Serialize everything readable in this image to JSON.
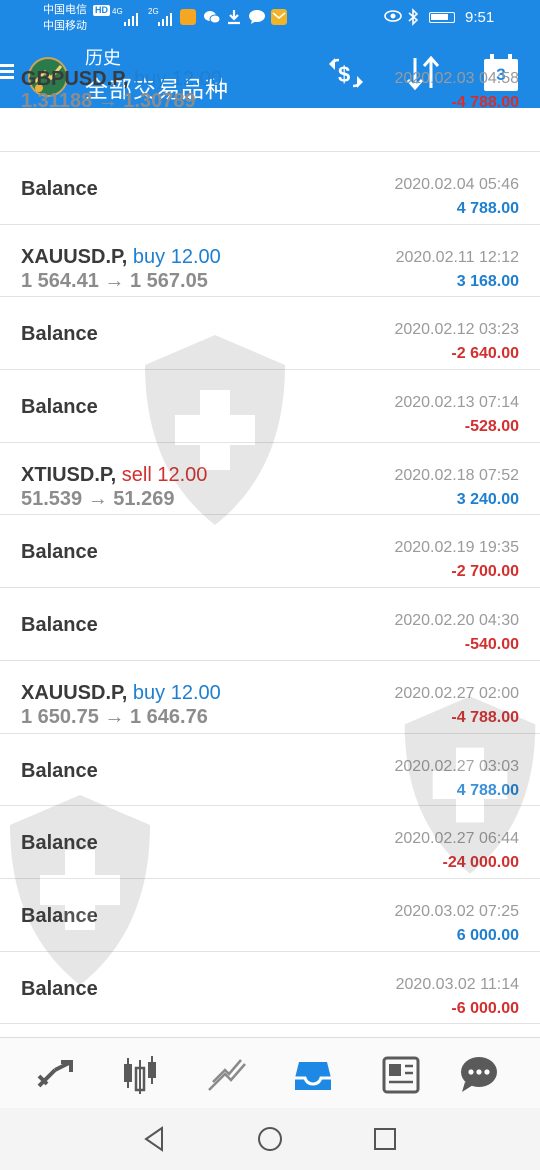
{
  "status_bar": {
    "carrier1": "中国电信",
    "carrier2": "中国移动",
    "hd": "HD",
    "net1": "4G",
    "net2": "2G",
    "time": "9:51"
  },
  "header": {
    "title": "历史",
    "subtitle": "全部交易品种",
    "calendar_day": "3",
    "icons": [
      "menu-icon",
      "app-logo",
      "currency-exchange-icon",
      "sort-icon",
      "calendar-icon"
    ]
  },
  "rows": [
    {
      "type": "trade",
      "symbol": "GBPUSD.P,",
      "side": "buy",
      "qty": "12.00",
      "prices": "1.31188 → 1.30789",
      "date": "2020.02.03 04:58",
      "amount": "-4 788.00",
      "sign": "neg"
    },
    {
      "type": "balance",
      "label": "Balance",
      "date": "2020.02.04 05:46",
      "amount": "4 788.00",
      "sign": "pos"
    },
    {
      "type": "trade",
      "symbol": "XAUUSD.P,",
      "side": "buy",
      "qty": "12.00",
      "prices": "1 564.41 → 1 567.05",
      "date": "2020.02.11 12:12",
      "amount": "3 168.00",
      "sign": "pos"
    },
    {
      "type": "balance",
      "label": "Balance",
      "date": "2020.02.12 03:23",
      "amount": "-2 640.00",
      "sign": "neg"
    },
    {
      "type": "balance",
      "label": "Balance",
      "date": "2020.02.13 07:14",
      "amount": "-528.00",
      "sign": "neg"
    },
    {
      "type": "trade",
      "symbol": "XTIUSD.P,",
      "side": "sell",
      "qty": "12.00",
      "prices": "51.539 → 51.269",
      "date": "2020.02.18 07:52",
      "amount": "3 240.00",
      "sign": "pos"
    },
    {
      "type": "balance",
      "label": "Balance",
      "date": "2020.02.19 19:35",
      "amount": "-2 700.00",
      "sign": "neg"
    },
    {
      "type": "balance",
      "label": "Balance",
      "date": "2020.02.20 04:30",
      "amount": "-540.00",
      "sign": "neg"
    },
    {
      "type": "trade",
      "symbol": "XAUUSD.P,",
      "side": "buy",
      "qty": "12.00",
      "prices": "1 650.75 → 1 646.76",
      "date": "2020.02.27 02:00",
      "amount": "-4 788.00",
      "sign": "neg"
    },
    {
      "type": "balance",
      "label": "Balance",
      "date": "2020.02.27 03:03",
      "amount": "4 788.00",
      "sign": "pos"
    },
    {
      "type": "balance",
      "label": "Balance",
      "date": "2020.02.27 06:44",
      "amount": "-24 000.00",
      "sign": "neg"
    },
    {
      "type": "balance",
      "label": "Balance",
      "date": "2020.03.02 07:25",
      "amount": "6 000.00",
      "sign": "pos"
    },
    {
      "type": "balance",
      "label": "Balance",
      "date": "2020.03.02 11:14",
      "amount": "-6 000.00",
      "sign": "neg"
    }
  ],
  "bottom_nav": {
    "items": [
      "quotes-icon",
      "chart-icon",
      "trade-icon",
      "history-icon",
      "news-icon",
      "chat-icon"
    ],
    "active": "history-icon",
    "active_color": "#1e88e5",
    "inactive_color": "#5a5a5a"
  },
  "system_nav": [
    "back-icon",
    "home-icon",
    "recents-icon"
  ],
  "colors": {
    "header": "#1e88e5",
    "positive": "#1e7fd0",
    "negative": "#d32f2f"
  }
}
